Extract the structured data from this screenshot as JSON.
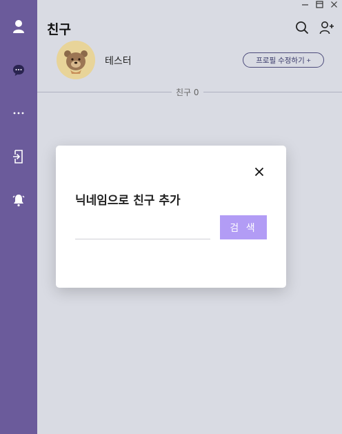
{
  "window": {
    "minimize_icon": "minimize-icon",
    "maximize_icon": "maximize-icon",
    "close_icon": "close-icon"
  },
  "sidebar": {
    "items": [
      {
        "name": "friends",
        "icon": "person-icon"
      },
      {
        "name": "chats",
        "icon": "chat-icon"
      },
      {
        "name": "more",
        "icon": "more-icon"
      },
      {
        "name": "logout",
        "icon": "logout-icon"
      },
      {
        "name": "notifications",
        "icon": "bell-icon"
      }
    ],
    "color": "#6b5b9b"
  },
  "header": {
    "title": "친구",
    "search_icon": "search-icon",
    "add_friend_icon": "add-friend-icon"
  },
  "profile": {
    "name": "테스터",
    "edit_label": "프로필 수정하기 +"
  },
  "friends_divider": {
    "label": "친구 0"
  },
  "modal": {
    "title": "닉네임으로 친구 추가",
    "input_value": "",
    "input_placeholder": "",
    "search_label": "검 색",
    "accent": "#b29cf5"
  }
}
